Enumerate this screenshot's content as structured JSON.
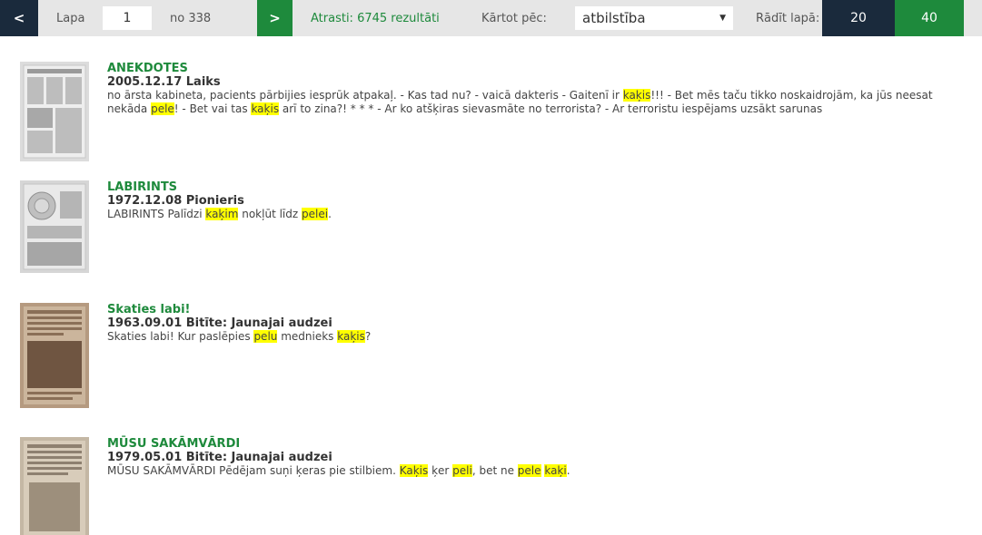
{
  "toolbar": {
    "prev_label": "<",
    "page_label": "Lapa",
    "page_value": "1",
    "of_total": "no 338",
    "next_label": ">",
    "found_prefix": "Atrasti: ",
    "found_count": "6745 rezultāti",
    "sort_label": "Kārtot pēc:",
    "sort_value": "atbilstība",
    "per_page_label": "Rādīt lapā:",
    "per_page_options": [
      "20",
      "40"
    ]
  },
  "results": [
    {
      "title": "ANEKDOTES",
      "meta": "2005.12.17 Laiks",
      "snippet": [
        {
          "t": "no ārsta kabineta, pacients pārbijies iesprūk atpakaļ. - Kas tad nu? - vaicā dakteris - Gaitenī ir "
        },
        {
          "t": "kaķis",
          "hl": true
        },
        {
          "t": "!!! - Bet mēs taču tikko noskaidrojām, ka jūs neesat nekāda "
        },
        {
          "t": "pele",
          "hl": true
        },
        {
          "t": "! - Bet vai tas "
        },
        {
          "t": "kaķis",
          "hl": true
        },
        {
          "t": " arī to zina?! * * * - Ar ko atšķiras sievasmāte no terrorista? - Ar terroristu iespējams uzsākt sarunas"
        }
      ]
    },
    {
      "title": "LABIRINTS",
      "meta": "1972.12.08 Pionieris",
      "snippet": [
        {
          "t": "LABIRINTS Palīdzi "
        },
        {
          "t": "kaķim",
          "hl": true
        },
        {
          "t": " nokļūt līdz "
        },
        {
          "t": "pelei",
          "hl": true
        },
        {
          "t": "."
        }
      ]
    },
    {
      "title": "Skaties labi!",
      "meta": "1963.09.01 Bitīte: Jaunajai audzei",
      "snippet": [
        {
          "t": "Skaties labi! Kur paslēpies "
        },
        {
          "t": "pelu",
          "hl": true
        },
        {
          "t": " mednieks "
        },
        {
          "t": "kaķis",
          "hl": true
        },
        {
          "t": "?"
        }
      ]
    },
    {
      "title": "MŪSU SAKĀMVĀRDI",
      "meta": "1979.05.01 Bitīte: Jaunajai audzei",
      "snippet": [
        {
          "t": "MŪSU SAKĀMVĀRDI Pēdējam suņi ķeras pie stilbiem. "
        },
        {
          "t": "Kaķis",
          "hl": true
        },
        {
          "t": " ķer "
        },
        {
          "t": "peli",
          "hl": true
        },
        {
          "t": ", bet ne "
        },
        {
          "t": "pele",
          "hl": true
        },
        {
          "t": " "
        },
        {
          "t": "kaķi",
          "hl": true
        },
        {
          "t": "."
        }
      ]
    }
  ],
  "colors": {
    "accent_green": "#1e8a3c",
    "nav_dark": "#1a2a3c",
    "bar_bg": "#e6e6e6",
    "highlight": "#ffff00"
  }
}
